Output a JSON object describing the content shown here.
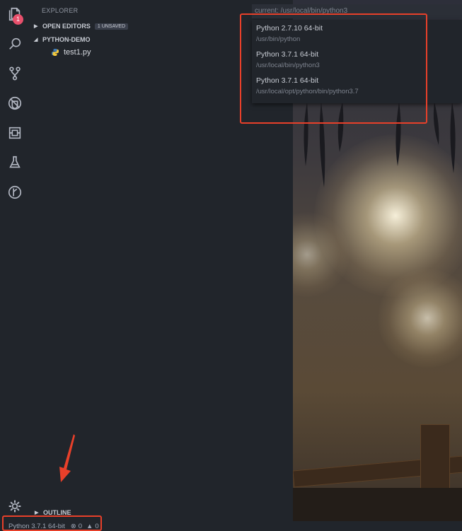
{
  "activity_bar": {
    "explorer_badge": "1",
    "icons": [
      "files-icon",
      "search-icon",
      "source-control-icon",
      "debug-icon",
      "extensions-icon",
      "test-flask-icon",
      "git-lens-icon"
    ]
  },
  "sidebar": {
    "title": "EXPLORER",
    "open_editors": {
      "label": "OPEN EDITORS",
      "badge": "1 UNSAVED"
    },
    "project": {
      "label": "PYTHON-DEMO"
    },
    "files": [
      {
        "name": "test1.py"
      }
    ],
    "outline": {
      "label": "OUTLINE"
    }
  },
  "quick_pick": {
    "input": "current: /usr/local/bin/python3",
    "items": [
      {
        "label": "Python 2.7.10 64-bit",
        "description": "/usr/bin/python"
      },
      {
        "label": "Python 3.7.1 64-bit",
        "description": "/usr/local/bin/python3"
      },
      {
        "label": "Python 3.7.1 64-bit",
        "description": "/usr/local/opt/python/bin/python3.7"
      }
    ]
  },
  "status_bar": {
    "interpreter": "Python 3.7.1 64-bit",
    "errors": "0",
    "warnings": "0"
  },
  "colors": {
    "highlight": "#e8402a",
    "badge": "#e8506c",
    "background": "#21252b"
  }
}
